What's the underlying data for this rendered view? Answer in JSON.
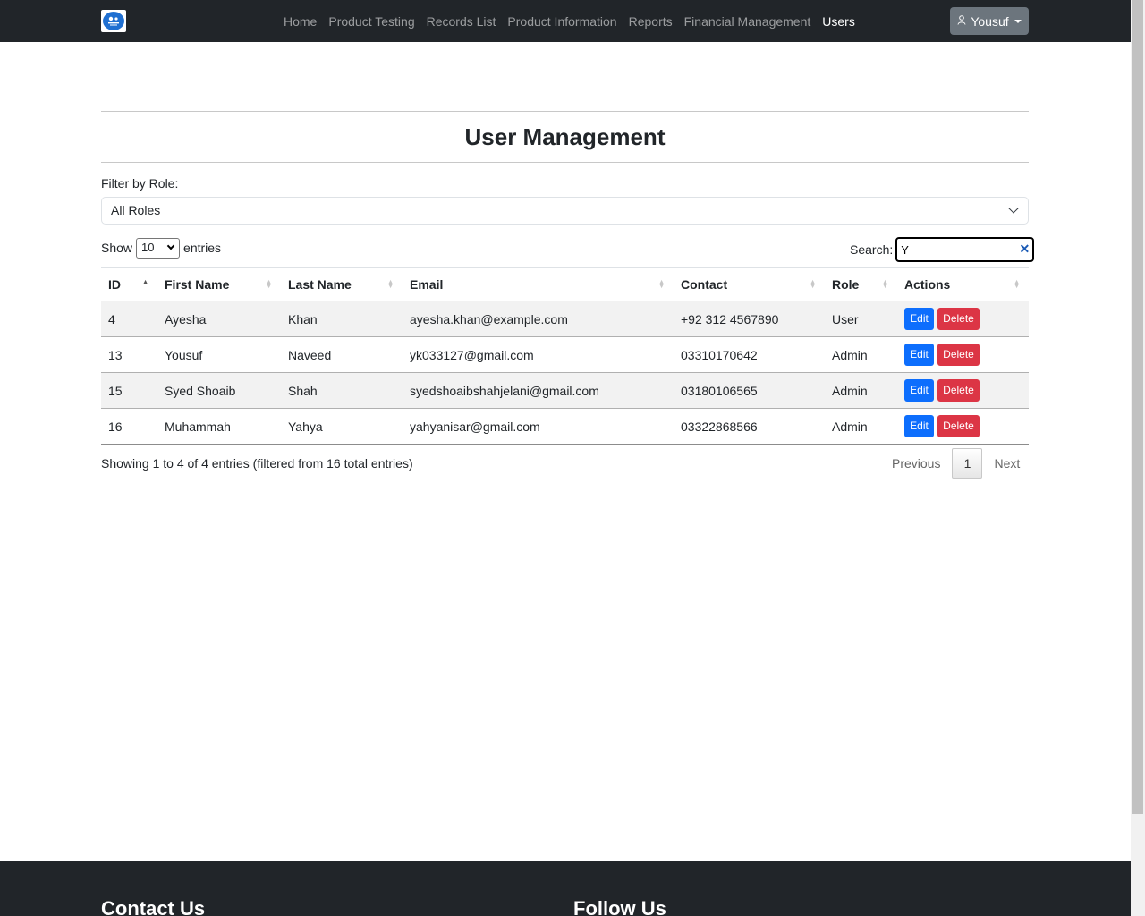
{
  "navbar": {
    "logo_text": "TESTING LAB",
    "links": [
      {
        "label": "Home",
        "active": false
      },
      {
        "label": "Product Testing",
        "active": false
      },
      {
        "label": "Records List",
        "active": false
      },
      {
        "label": "Product Information",
        "active": false
      },
      {
        "label": "Reports",
        "active": false
      },
      {
        "label": "Financial Management",
        "active": false
      },
      {
        "label": "Users",
        "active": true
      }
    ],
    "user_menu_label": "Yousuf",
    "user_icon": "person-icon"
  },
  "page": {
    "title": "User Management",
    "filter_label": "Filter by Role:",
    "role_select_value": "All Roles"
  },
  "table_controls": {
    "show_label": "Show",
    "entries_value": "10",
    "entries_label": "entries",
    "search_label": "Search:",
    "search_value": "Y",
    "clear_icon": "close-icon"
  },
  "table": {
    "columns": [
      "ID",
      "First Name",
      "Last Name",
      "Email",
      "Contact",
      "Role",
      "Actions"
    ],
    "sorted_column": "ID",
    "rows": [
      {
        "id": "4",
        "first_name": "Ayesha",
        "last_name": "Khan",
        "email": "ayesha.khan@example.com",
        "contact": "+92 312 4567890",
        "role": "User"
      },
      {
        "id": "13",
        "first_name": "Yousuf",
        "last_name": "Naveed",
        "email": "yk033127@gmail.com",
        "contact": "03310170642",
        "role": "Admin"
      },
      {
        "id": "15",
        "first_name": "Syed Shoaib",
        "last_name": "Shah",
        "email": "syedshoaibshahjelani@gmail.com",
        "contact": "03180106565",
        "role": "Admin"
      },
      {
        "id": "16",
        "first_name": "Muhammah",
        "last_name": "Yahya",
        "email": "yahyanisar@gmail.com",
        "contact": "03322868566",
        "role": "Admin"
      }
    ],
    "edit_label": "Edit",
    "delete_label": "Delete"
  },
  "pagination": {
    "info": "Showing 1 to 4 of 4 entries (filtered from 16 total entries)",
    "previous": "Previous",
    "current_page": "1",
    "next": "Next"
  },
  "footer": {
    "contact_heading": "Contact Us",
    "follow_heading": "Follow Us"
  },
  "colors": {
    "navbar_bg": "#212529",
    "primary": "#0d6efd",
    "danger": "#dc3545",
    "secondary": "#6c757d"
  }
}
